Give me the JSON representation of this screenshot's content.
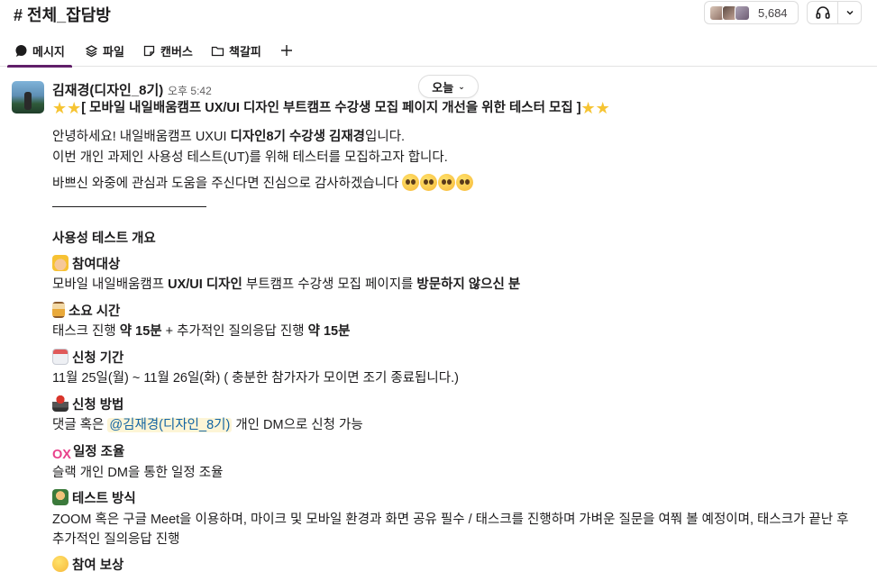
{
  "header": {
    "channel_title": "# 전체_잡담방",
    "member_count": "5,684"
  },
  "tabs": [
    {
      "label": "메시지"
    },
    {
      "label": "파일"
    },
    {
      "label": "캔버스"
    },
    {
      "label": "책갈피"
    }
  ],
  "message": {
    "sender": "김재경(디자인_8기)",
    "time": "오후 5:42",
    "date_pill": "오늘",
    "title_text": "[ 모바일 내일배움캠프 UX/UI 디자인 부트캠프 수강생 모집 페이지 개선을 위한 테스터 모집 ]",
    "intro_1a": "안녕하세요! 내일배움캠프 UXUI ",
    "intro_1b": "디자인8기 수강생 김재경",
    "intro_1c": "입니다.",
    "intro_2": "이번 개인 과제인 사용성 테스트(UT)를 위해 테스터를 모집하고자 합니다.",
    "intro_3": "바쁘신 와중에 관심과 도움을 주신다면 진심으로 감사하겠습니다",
    "overview_heading": "사용성 테스트 개요",
    "sections": [
      {
        "icon": "construction-worker-icon",
        "heading": "참여대상"
      },
      {
        "icon": "hourglass-icon",
        "heading": "소요 시간"
      },
      {
        "icon": "calendar-icon",
        "heading": "신청 기간"
      },
      {
        "icon": "joystick-icon",
        "heading": "신청 방법"
      },
      {
        "icon": "ox-icon",
        "heading": "일정 조율"
      },
      {
        "icon": "teacher-icon",
        "heading": "테스트 방식"
      },
      {
        "icon": "smile-icon",
        "heading": "참여 보상"
      }
    ],
    "target_a": "모바일 내일배움캠프 ",
    "target_b": "UX/UI 디자인",
    "target_c": " 부트캠프 수강생 모집 페이지를 ",
    "target_d": "방문하지 않으신 분",
    "duration_a": "태스크 진행 ",
    "duration_b": "약 15분",
    "duration_c": " + 추가적인 질의응답 진행 ",
    "duration_d": "약 15분",
    "period": "11월 25일(월) ~ 11월 26일(화) ( 충분한 참가자가 모이면 조기 종료됩니다.)",
    "apply_a": "댓글 혹은 ",
    "apply_mention": "@김재경(디자인_8기)",
    "apply_b": " 개인 DM으로 신청 가능",
    "schedule": "슬랙 개인 DM을 통한 일정 조율",
    "method_1": " ZOOM 혹은 구글 Meet을 이용하며, 마이크 및 모바일 환경과 화면 공유 필수 / 태스크를 진행하며 가벼운 질문을 여쭤 볼 예정이며, 태스크가 끝난 후",
    "method_2": "추가적인 질의응답 진행"
  }
}
